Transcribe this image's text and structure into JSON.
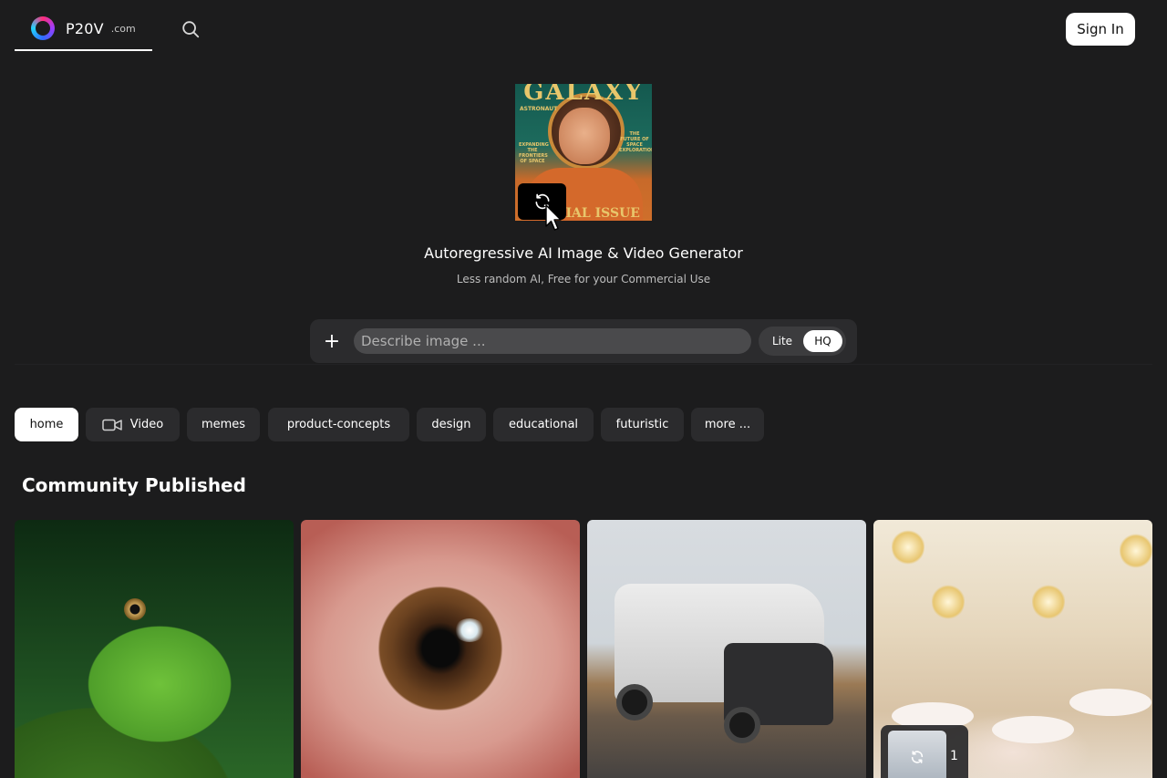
{
  "header": {
    "brand_name": "P20V",
    "brand_tld": ".com",
    "signin_label": "Sign In"
  },
  "hero": {
    "image_text": {
      "title": "GALAXY",
      "subtitle": "ASTRONAUT",
      "left_tag": "EXPANDING THE FRONTIERS OF SPACE",
      "right_tag": "THE FUTURE OF SPACE EXPLORATION",
      "bottom": "SPECIAL ISSUE"
    },
    "title": "Autoregressive AI Image & Video Generator",
    "subtitle": "Less random AI, Free for your Commercial Use"
  },
  "prompt": {
    "add_label": "+",
    "placeholder": "Describe image ...",
    "quality_options": [
      "Lite",
      "HQ"
    ],
    "quality_selected": "HQ"
  },
  "categories": [
    {
      "label": "home",
      "active": true
    },
    {
      "label": "Video",
      "icon": "video-camera-icon"
    },
    {
      "label": "memes"
    },
    {
      "label": "product-concepts"
    },
    {
      "label": "design"
    },
    {
      "label": "educational"
    },
    {
      "label": "futuristic"
    },
    {
      "label": "more ..."
    }
  ],
  "community": {
    "title": "Community Published",
    "collection_count": "1"
  },
  "colors": {
    "background": "#1c1c1d",
    "chip": "#2b2b2d",
    "accent_white": "#ffffff"
  }
}
